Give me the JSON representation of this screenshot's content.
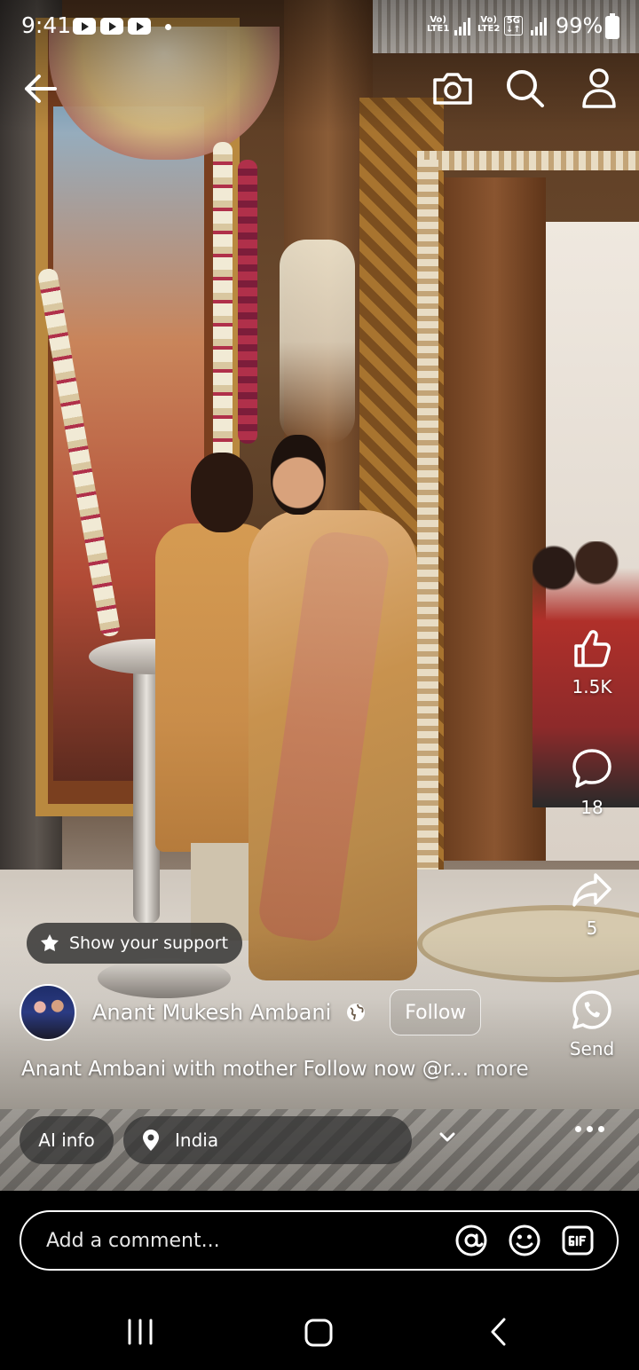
{
  "status_bar": {
    "time": "9:41",
    "network1_top": "Vo)",
    "network1_bottom": "LTE1",
    "network2_top": "Vo)",
    "network2_bottom": "LTE2",
    "network3_top": "5G",
    "network3_bottom": "↓↑",
    "battery": "99%"
  },
  "top_bar": {
    "back_icon": "arrow-left-icon",
    "camera_icon": "camera-icon",
    "search_icon": "search-icon",
    "profile_icon": "profile-icon"
  },
  "actions": {
    "like_count": "1.5K",
    "comment_count": "18",
    "share_count": "5",
    "send_label": "Send"
  },
  "post": {
    "support_label": "Show your support",
    "author": "Anant Mukesh Ambani",
    "follow_label": "Follow",
    "caption": "Anant Ambani with mother Follow now @r...",
    "more_label": "more",
    "ai_info_label": "AI info",
    "location": "India"
  },
  "comment_bar": {
    "placeholder": "Add a comment..."
  },
  "colors": {
    "overlay_chip": "#323232",
    "text": "#ffffff",
    "background": "#000000"
  }
}
